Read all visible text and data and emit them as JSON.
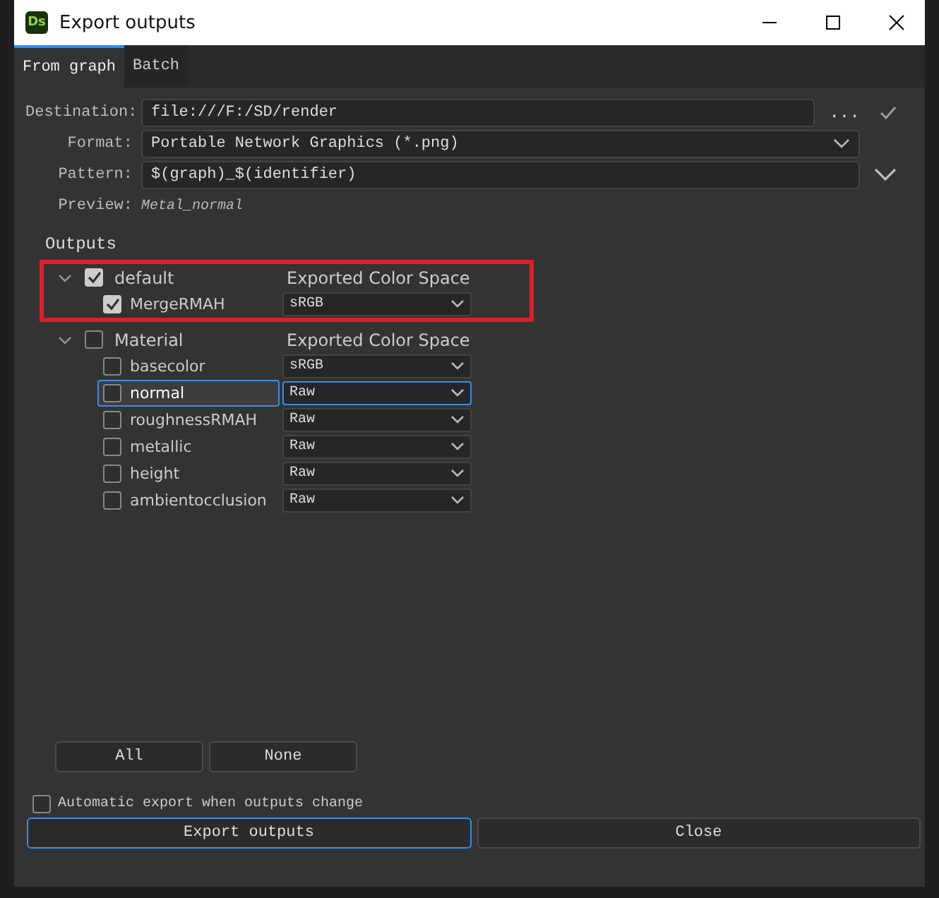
{
  "window": {
    "title": "Export outputs",
    "logo": "Ds"
  },
  "tabs": [
    {
      "label": "From graph",
      "selected": true
    },
    {
      "label": "Batch",
      "selected": false
    }
  ],
  "form": {
    "destination": {
      "label": "Destination:",
      "value": "file:///F:/SD/render",
      "browse": "..."
    },
    "format": {
      "label": "Format:",
      "value": "Portable Network Graphics (*.png)"
    },
    "pattern": {
      "label": "Pattern:",
      "value": "$(graph)_$(identifier)"
    },
    "preview": {
      "label": "Preview:",
      "value": "Metal_normal"
    }
  },
  "outputs": {
    "label": "Outputs",
    "groups": [
      {
        "name": "default",
        "checked": true,
        "expanded": true,
        "highlighted": true,
        "column_header": "Exported Color Space",
        "children": [
          {
            "name": "MergeRMAH",
            "checked": true,
            "selected": false,
            "color_space": "sRGB"
          }
        ]
      },
      {
        "name": "Material",
        "checked": false,
        "expanded": true,
        "column_header": "Exported Color Space",
        "children": [
          {
            "name": "basecolor",
            "checked": false,
            "selected": false,
            "color_space": "sRGB"
          },
          {
            "name": "normal",
            "checked": false,
            "selected": true,
            "color_space": "Raw"
          },
          {
            "name": "roughnessRMAH",
            "checked": false,
            "selected": false,
            "color_space": "Raw"
          },
          {
            "name": "metallic",
            "checked": false,
            "selected": false,
            "color_space": "Raw"
          },
          {
            "name": "height",
            "checked": false,
            "selected": false,
            "color_space": "Raw"
          },
          {
            "name": "ambientocclusion",
            "checked": false,
            "selected": false,
            "color_space": "Raw"
          }
        ]
      }
    ]
  },
  "select_buttons": [
    "All",
    "None"
  ],
  "auto_export": {
    "label": "Automatic export when outputs change",
    "checked": false
  },
  "buttons": [
    {
      "label": "Export outputs",
      "default": true
    },
    {
      "label": "Close",
      "default": false
    }
  ]
}
